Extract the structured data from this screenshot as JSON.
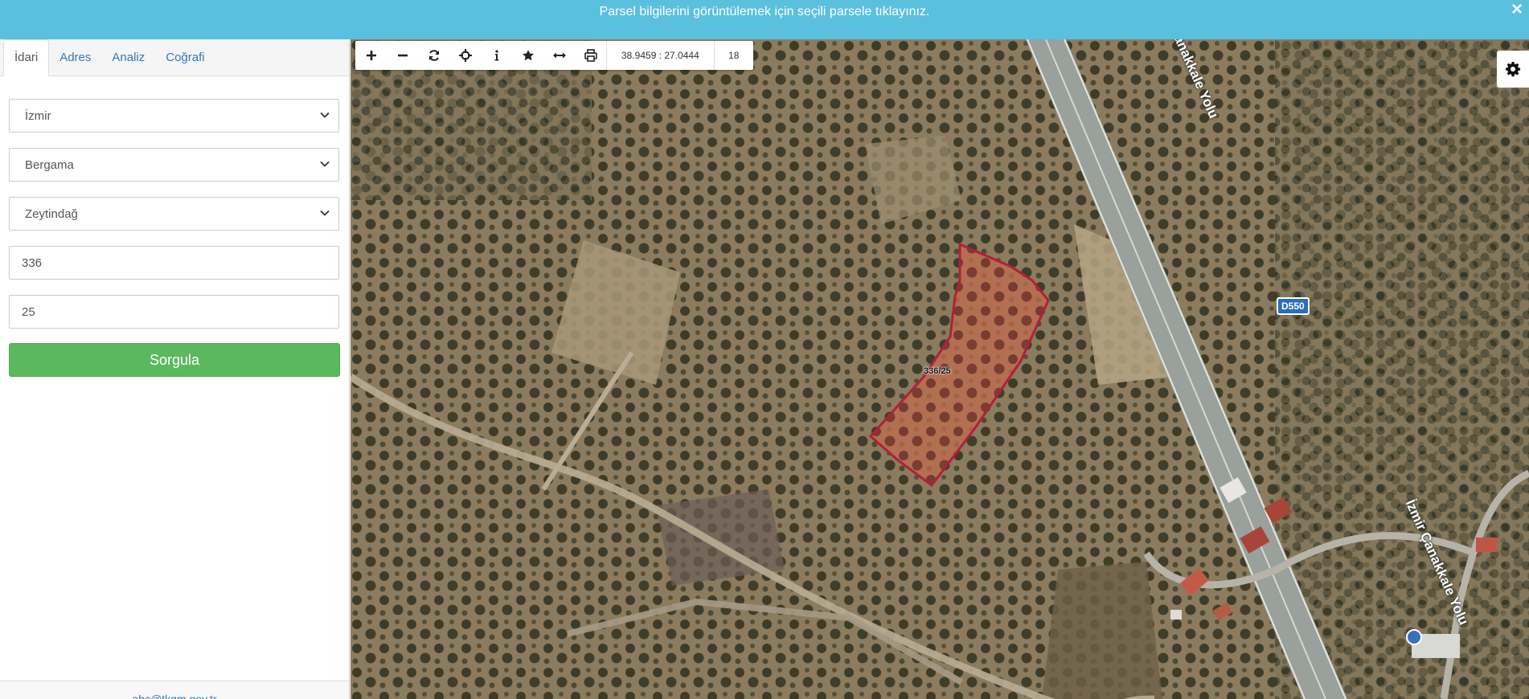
{
  "notice": {
    "message": "Parsel bilgilerini görüntülemek için seçili parsele tıklayınız.",
    "close_symbol": "×"
  },
  "tabs": [
    {
      "label": "İdari",
      "active": true
    },
    {
      "label": "Adres",
      "active": false
    },
    {
      "label": "Analiz",
      "active": false
    },
    {
      "label": "Coğrafi",
      "active": false
    }
  ],
  "form": {
    "il": "İzmir",
    "ilce": "Bergama",
    "mahalle": "Zeytindağ",
    "ada": "336",
    "parsel": "25",
    "submit_label": "Sorgula"
  },
  "footer": {
    "email": "abc@tkgm.gov.tr"
  },
  "map": {
    "coordinates": "38.9459 : 27.0444",
    "zoom_level": "18",
    "parcel_label": "336/25",
    "road_label_top": "Çanakkale Yolu",
    "road_label_bottom": "İzmir Çanakkale Yolu",
    "road_shield": "D550",
    "parcel_color": "#b0203a",
    "toolbar_icons": [
      "plus-icon",
      "minus-icon",
      "refresh-icon",
      "crosshair-icon",
      "info-icon",
      "star-icon",
      "measure-icon",
      "print-icon"
    ]
  },
  "colors": {
    "notice_bg": "#5bc0de",
    "primary_button": "#5cb85c",
    "link": "#337ab7"
  }
}
